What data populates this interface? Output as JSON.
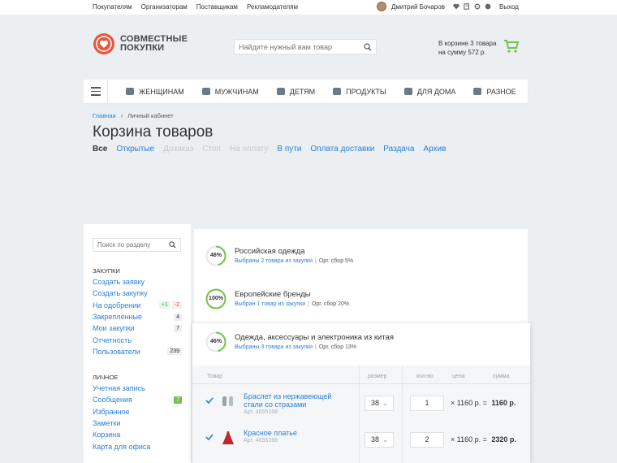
{
  "topbar": {
    "links": [
      "Покупателям",
      "Организаторам",
      "Поставщикам",
      "Рекламодателям"
    ],
    "user_name": "Дмитрий Бочаров",
    "logout": "Выход",
    "icons": [
      "heart-icon",
      "edit-icon",
      "gear-icon",
      "globe-icon"
    ]
  },
  "header": {
    "logo_line1": "СОВМЕСТНЫЕ",
    "logo_line2": "ПОКУПКИ",
    "search_placeholder": "Найдите нужный вам товар",
    "cart_line1": "В корзине 3 товара",
    "cart_line2": "на сумму 572 р."
  },
  "nav": {
    "items": [
      {
        "label": "ЖЕНЩИНАМ",
        "icon": "women-icon"
      },
      {
        "label": "МУЖЧИНАМ",
        "icon": "men-icon"
      },
      {
        "label": "ДЕТЯМ",
        "icon": "kids-icon"
      },
      {
        "label": "ПРОДУКТЫ",
        "icon": "food-icon"
      },
      {
        "label": "ДЛЯ ДОМА",
        "icon": "home-icon"
      },
      {
        "label": "РАЗНОЕ",
        "icon": "misc-icon"
      }
    ]
  },
  "breadcrumb": {
    "home": "Главная",
    "current": "Личный кабинет"
  },
  "page_title": "Корзина товаров",
  "status_tabs": [
    {
      "label": "Все",
      "state": "active"
    },
    {
      "label": "Открытые",
      "state": "link"
    },
    {
      "label": "Дозаказ",
      "state": "disabled"
    },
    {
      "label": "Стоп",
      "state": "disabled"
    },
    {
      "label": "На оплату",
      "state": "disabled"
    },
    {
      "label": "В пути",
      "state": "link"
    },
    {
      "label": "Оплата доставки",
      "state": "link"
    },
    {
      "label": "Раздача",
      "state": "link"
    },
    {
      "label": "Архив",
      "state": "link"
    }
  ],
  "sidebar": {
    "search_placeholder": "Поиск по разделу",
    "section1_title": "ЗАКУПКИ",
    "section1_items": [
      {
        "label": "Создать заявку"
      },
      {
        "label": "Создать закупку"
      },
      {
        "label": "На одобрении",
        "badge_plus": "+1",
        "badge_minus": "-2"
      },
      {
        "label": "Закрепленные",
        "badge": "4"
      },
      {
        "label": "Мои закупки",
        "badge": "7"
      },
      {
        "label": "Отчетность"
      },
      {
        "label": "Пользователи",
        "badge": "239"
      }
    ],
    "section2_title": "ЛИЧНОЕ",
    "section2_items": [
      {
        "label": "Учетная запись"
      },
      {
        "label": "Сообщения",
        "badge": "7"
      },
      {
        "label": "Избранное"
      },
      {
        "label": "Заметки"
      },
      {
        "label": "Корзина"
      },
      {
        "label": "Карта для офиса"
      }
    ]
  },
  "groups": [
    {
      "percent": 46,
      "percent_label": "46%",
      "name": "Российская одежда",
      "selected": "Выбраны 2 товара из закупки",
      "fee": "Орг. сбор 5%"
    },
    {
      "percent": 100,
      "percent_label": "100%",
      "name": "Европейские бренды",
      "selected": "Выбран 1 товар из закупки",
      "fee": "Орг. сбор 20%"
    },
    {
      "percent": 46,
      "percent_label": "46%",
      "name": "Одежда, аксессуары и электроника из китая",
      "selected": "Выбраны 3 товара из закупки",
      "fee": "Орг. сбор 13%"
    }
  ],
  "table": {
    "headers": {
      "product": "Товар",
      "size": "размер",
      "qty": "кол-во",
      "price": "цена",
      "sum": "сумма"
    },
    "rows": [
      {
        "name": "Браслет из нержавеющей стали со стразами",
        "art": "Арт. 4655168",
        "size": "38",
        "qty": "1",
        "price": "1160 р.",
        "total": "1160 р."
      },
      {
        "name": "Красное платье",
        "art": "Арт. 4655168",
        "size": "38",
        "qty": "2",
        "price": "1160 р.",
        "total": "2320 р."
      }
    ]
  },
  "colors": {
    "accent": "#2a7fd4",
    "green": "#78c04b",
    "logo": "#e8583f"
  }
}
